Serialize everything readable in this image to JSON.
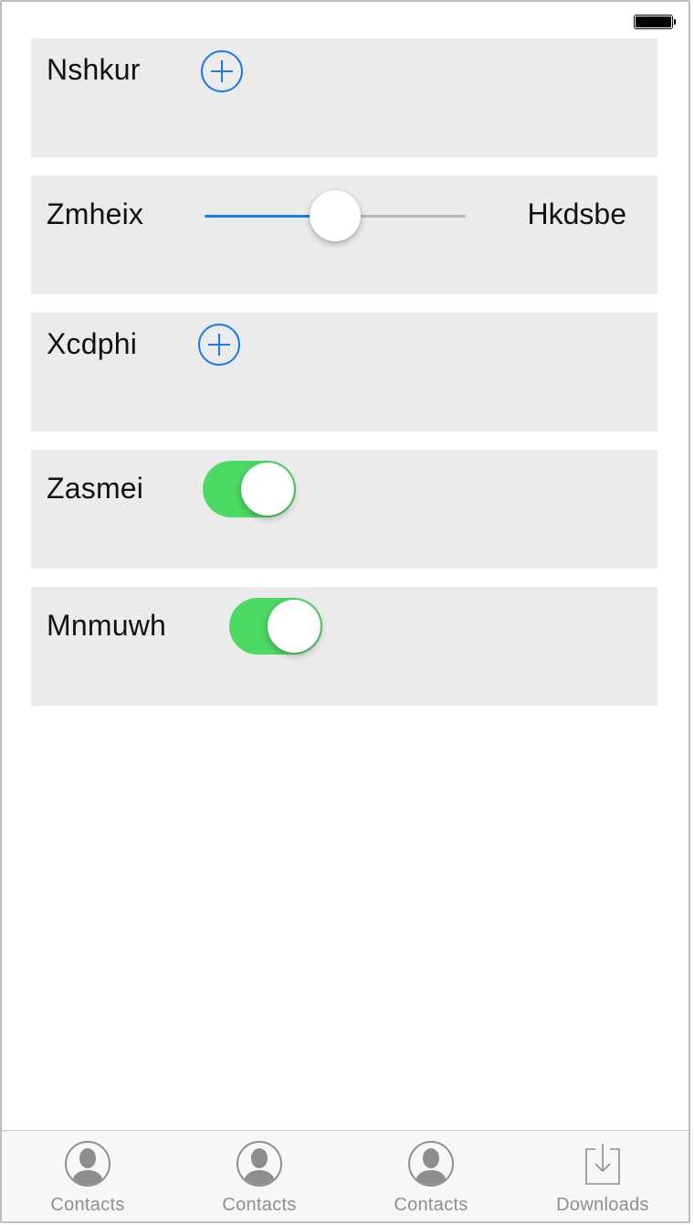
{
  "status_bar": {
    "battery_icon": "battery-full-icon"
  },
  "rows": [
    {
      "label": "Nshkur",
      "control": "add-button",
      "icon": "plus-circle-icon"
    },
    {
      "label": "Zmheix",
      "control": "slider",
      "value": 0.5,
      "right_label": "Hkdsbe"
    },
    {
      "label": "Xcdphi",
      "control": "add-button",
      "icon": "plus-circle-icon"
    },
    {
      "label": "Zasmei",
      "control": "toggle",
      "on": true
    },
    {
      "label": "Mnmuwh",
      "control": "toggle",
      "on": true
    }
  ],
  "tabbar": {
    "tabs": [
      {
        "label": "Contacts",
        "icon": "contact-avatar-icon"
      },
      {
        "label": "Contacts",
        "icon": "contact-avatar-icon"
      },
      {
        "label": "Contacts",
        "icon": "contact-avatar-icon"
      },
      {
        "label": "Downloads",
        "icon": "download-tray-icon"
      }
    ]
  },
  "colors": {
    "accent_blue": "#1a7ae6",
    "toggle_green": "#4cd964",
    "row_background": "#ebebeb",
    "tab_inactive": "#8e8e8e"
  }
}
